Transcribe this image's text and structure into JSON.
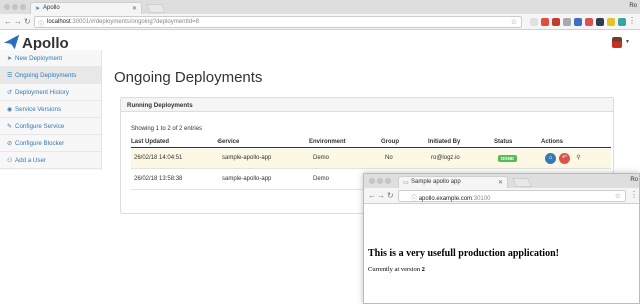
{
  "browser": {
    "tab_title": "Apollo",
    "user_corner": "Ro",
    "url_host": "localhost",
    "url_rest": ":30001/#/deployments/ongoing?deploymentId=8"
  },
  "app": {
    "logo_text": "Apollo"
  },
  "sidebar": {
    "items": [
      {
        "label": "New Deployment",
        "icon": "paper-plane-icon"
      },
      {
        "label": "Ongoing Deployments",
        "icon": "list-icon"
      },
      {
        "label": "Deployment History",
        "icon": "history-icon"
      },
      {
        "label": "Service Versions",
        "icon": "eye-icon"
      },
      {
        "label": "Configure Service",
        "icon": "edit-icon"
      },
      {
        "label": "Configure Blocker",
        "icon": "ban-icon"
      },
      {
        "label": "Add a User",
        "icon": "user-plus-icon"
      }
    ]
  },
  "main": {
    "title": "Ongoing Deployments",
    "panel_title": "Running Deployments",
    "entries_text": "Showing 1 to 2 of 2 entries",
    "columns": [
      "Last Updated",
      "Service",
      "Environment",
      "Group",
      "Initiated By",
      "Status",
      "Actions"
    ],
    "rows": [
      {
        "last_updated": "26/02/18 14:04:51",
        "service": "sample-apollo-app",
        "environment": "Demo",
        "group": "No",
        "initiated_by": "ro@logz.io",
        "status": "DONE"
      },
      {
        "last_updated": "26/02/18 13:58:38",
        "service": "sample-apollo-app",
        "environment": "Demo",
        "group": "",
        "initiated_by": "",
        "status": ""
      }
    ]
  },
  "popup": {
    "tab_title": "Sample apollo app",
    "user_corner": "Ro",
    "url_host": "apollo.example.com",
    "url_rest": ":30100",
    "heading": "This is a very usefull production application!",
    "version_prefix": "Currently at version ",
    "version": "2"
  },
  "colors": {
    "link": "#337ab7",
    "done": "#5cb85c",
    "highlight_row": "#fcf8e3"
  }
}
